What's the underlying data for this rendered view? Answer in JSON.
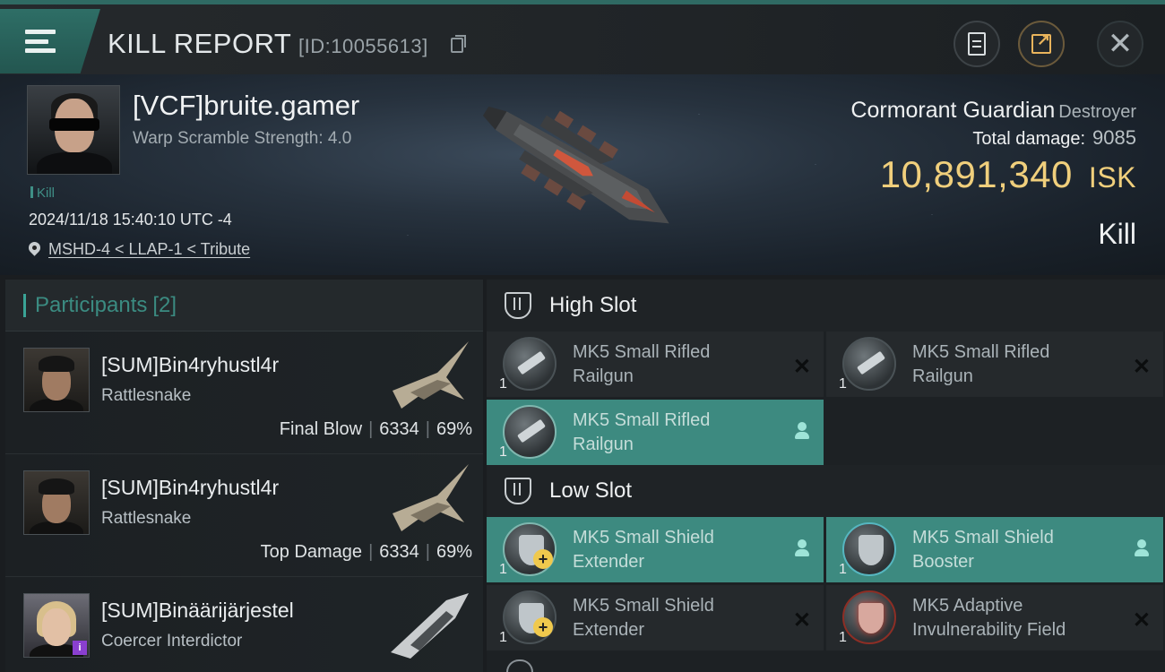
{
  "header": {
    "title": "KILL REPORT",
    "report_id": "[ID:10055613]"
  },
  "victim": {
    "name": "[VCF]bruite.gamer",
    "warp_scramble": "Warp Scramble Strength: 4.0",
    "tag": "Kill",
    "timestamp": "2024/11/18 15:40:10 UTC -4",
    "location": "MSHD-4 < LLAP-1 < Tribute",
    "ship_name": "Cormorant Guardian",
    "ship_type": "Destroyer",
    "total_damage_label": "Total damage:",
    "total_damage": "9085",
    "isk_value": "10,891,340",
    "isk_unit": "ISK",
    "result": "Kill"
  },
  "participants": {
    "title": "Participants",
    "count": "[2]",
    "rows": [
      {
        "name": "[SUM]Bin4ryhustl4r",
        "ship": "Rattlesnake",
        "role": "Final Blow",
        "damage": "6334",
        "percent": "69%"
      },
      {
        "name": "[SUM]Bin4ryhustl4r",
        "ship": "Rattlesnake",
        "role": "Top Damage",
        "damage": "6334",
        "percent": "69%"
      },
      {
        "name": "[SUM]Binäärijärjestel",
        "ship": "Coercer Interdictor",
        "badge": "i"
      }
    ]
  },
  "fitting": {
    "high_slot": {
      "title": "High Slot",
      "modules": [
        {
          "line1": "MK5 Small Rifled",
          "line2": "Railgun",
          "qty": "1",
          "state": "destroyed"
        },
        {
          "line1": "MK5 Small Rifled",
          "line2": "Railgun",
          "qty": "1",
          "state": "destroyed"
        },
        {
          "line1": "MK5 Small Rifled",
          "line2": "Railgun",
          "qty": "1",
          "state": "dropped"
        }
      ]
    },
    "low_slot": {
      "title": "Low Slot",
      "modules": [
        {
          "line1": "MK5 Small Shield",
          "line2": "Extender",
          "qty": "1",
          "state": "dropped"
        },
        {
          "line1": "MK5 Small Shield",
          "line2": "Booster",
          "qty": "1",
          "state": "dropped"
        },
        {
          "line1": "MK5 Small Shield",
          "line2": "Extender",
          "qty": "1",
          "state": "destroyed"
        },
        {
          "line1": "MK5 Adaptive",
          "line2": "Invulnerability Field",
          "qty": "1",
          "state": "destroyed"
        }
      ]
    }
  },
  "colors": {
    "accent_teal": "#3d8a80",
    "isk_gold": "#f0cf7c"
  }
}
